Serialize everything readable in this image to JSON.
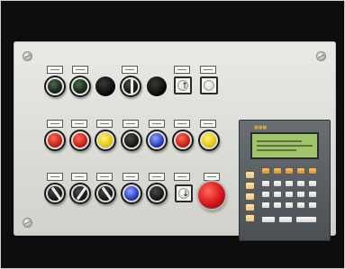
{
  "photo": {
    "subject": "machine-control-panel",
    "colors": {
      "background": "#0d0d0d",
      "panel": "#dcdcd7",
      "red": "#c41a12",
      "yellow": "#e3c20c",
      "blue": "#2434b8",
      "lcd": "#9fc46a"
    }
  }
}
